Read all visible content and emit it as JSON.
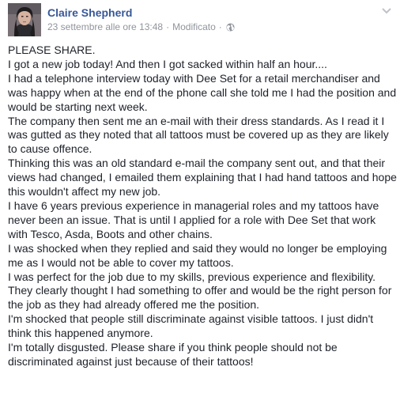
{
  "post": {
    "author": "Claire Shepherd",
    "timestamp": "23 settembre alle ore 13:48",
    "separator": "·",
    "edited": "Modificato",
    "privacy_icon": "globe-icon",
    "menu_icon": "chevron-down-icon",
    "paragraphs": [
      "PLEASE SHARE.",
      "I got a new job today! And then I got sacked within half an hour....",
      "I had a telephone interview today with Dee Set for a retail merchandiser and was happy when at the end of the phone call she told me I had the position and would be starting next week.",
      "The company then sent me an e-mail with their dress standards. As I read it I was gutted as they noted that all tattoos must be covered up as they are likely to cause offence.",
      "Thinking this was an old standard e-mail the company sent out, and that their views had changed, I emailed them explaining that I had hand tattoos and hope this wouldn't affect my new job.",
      "I have 6 years previous experience in managerial roles and my tattoos have never been an issue. That is until I applied for a role with Dee Set that work with Tesco, Asda, Boots and other chains.",
      "I was shocked when they replied and said they would no longer be employing me as I would not be able to cover my tattoos.",
      "I was perfect for the job due to my skills, previous experience and flexibility. They clearly thought I had something to offer and would be the right person for the job as they had already offered me the position.",
      "I'm shocked that people still discriminate against visible tattoos. I just didn't think this happened anymore.",
      "I'm totally disgusted. Please share if you think people should not be discriminated against just because of their tattoos!"
    ]
  },
  "colors": {
    "author_link": "#365899",
    "meta_text": "#90949c",
    "body_text": "#1d2129"
  }
}
